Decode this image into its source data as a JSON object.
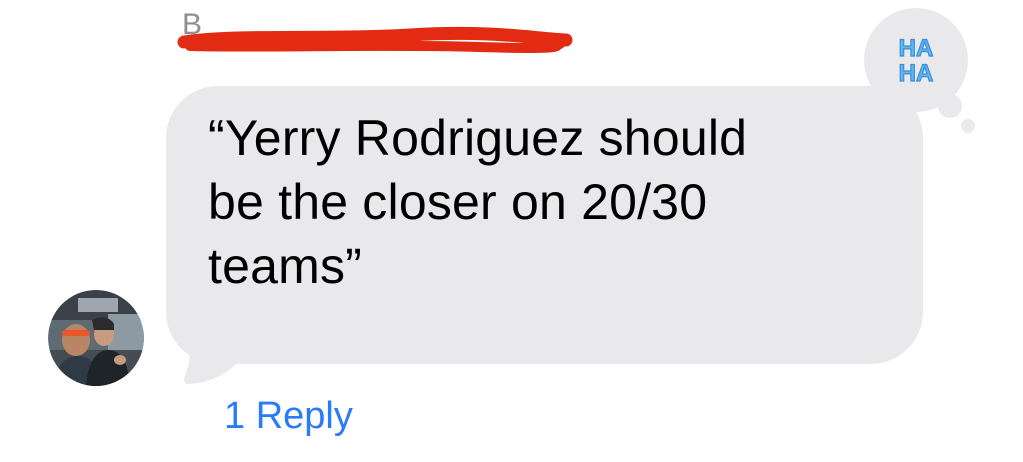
{
  "message": {
    "sender_name": "B",
    "text_lines": [
      "“Yerry Rodriguez should",
      "be the closer on 20/30",
      "teams”"
    ],
    "bubble_color": "#e9e9eb"
  },
  "tapback": {
    "icon": "haha-icon",
    "label": "HA HA",
    "color": "#5fb6f2"
  },
  "avatar": {
    "icon": "avatar-photo"
  },
  "thread": {
    "reply_label": "1 Reply",
    "link_color": "#2a7bf6"
  },
  "redaction": {
    "color": "#e32a12"
  }
}
